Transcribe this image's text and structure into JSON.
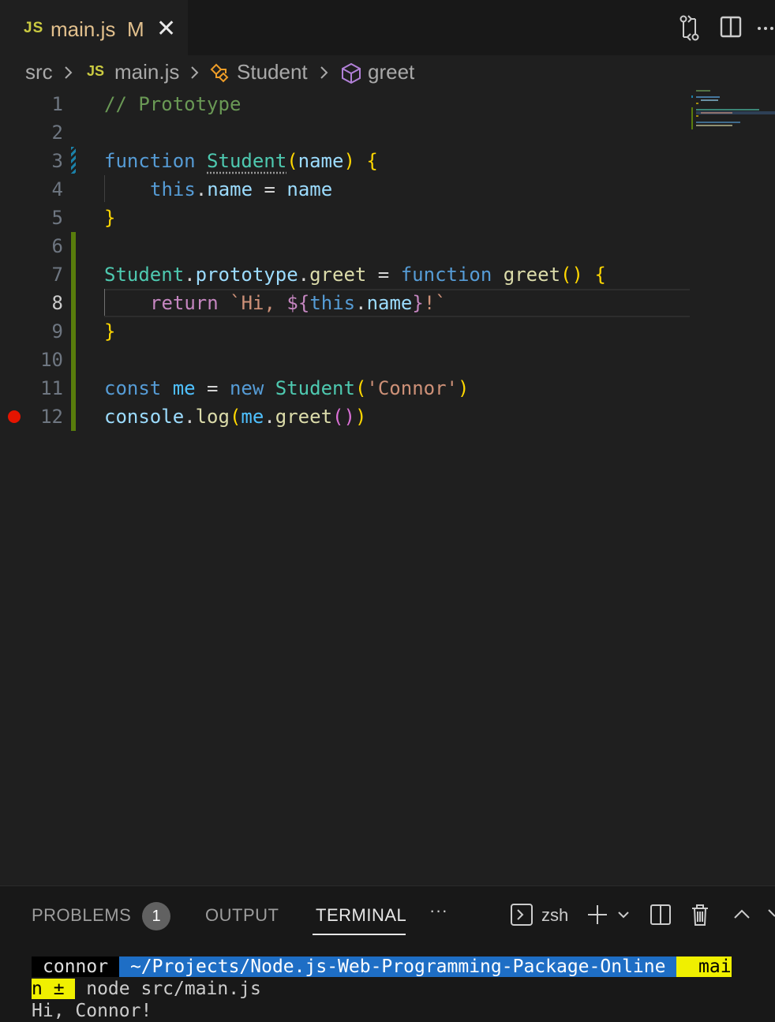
{
  "tab": {
    "lang_badge": "JS",
    "file_name": "main.js",
    "modified_flag": "M",
    "close_glyph": "✕"
  },
  "tab_actions": [
    "source-control-compare-icon",
    "split-editor-icon",
    "more-actions-icon"
  ],
  "breadcrumb": {
    "folder": "src",
    "file_badge": "JS",
    "file": "main.js",
    "symbol1": "Student",
    "symbol2": "greet",
    "separator": ">"
  },
  "editor": {
    "line_numbers": [
      "1",
      "2",
      "3",
      "4",
      "5",
      "6",
      "7",
      "8",
      "9",
      "10",
      "11",
      "12"
    ],
    "active_line": 8,
    "breakpoint_line": 12
  },
  "code": {
    "l1": "// Prototype",
    "l3": [
      "function",
      " ",
      "Student",
      "(",
      "name",
      ")",
      " ",
      "{"
    ],
    "l4": [
      "this",
      ".",
      "name",
      " = ",
      "name"
    ],
    "l5": "}",
    "l7": [
      "Student",
      ".",
      "prototype",
      ".",
      "greet",
      " = ",
      "function",
      " ",
      "greet",
      "(",
      ")",
      " ",
      "{"
    ],
    "l8": [
      "return",
      " `Hi, ",
      "${",
      "this",
      ".",
      "name",
      "}",
      "!`"
    ],
    "l9": "}",
    "l11": [
      "const",
      " ",
      "me",
      " = ",
      "new",
      " ",
      "Student",
      "(",
      "'Connor'",
      ")"
    ],
    "l12": [
      "console",
      ".",
      "log",
      "(",
      "me",
      ".",
      "greet",
      "(",
      ")",
      ")"
    ]
  },
  "panel": {
    "tabs": [
      "PROBLEMS",
      "OUTPUT",
      "TERMINAL"
    ],
    "problems_count": "1",
    "more": "···",
    "shell_name": "zsh",
    "active_tab": "TERMINAL"
  },
  "terminal": {
    "user": "connor",
    "path": " ~/Projects/Node.js-Web-Programming-Package-Online ",
    "git_glyphs": " ",
    "branch_part1": " mai",
    "branch_part2": "n ± ",
    "command": " node src/main.js",
    "output": "Hi, Connor!",
    "glyph": ""
  }
}
